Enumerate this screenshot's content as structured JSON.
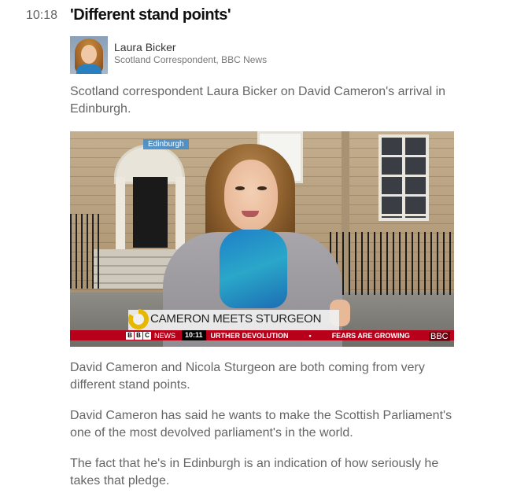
{
  "entry": {
    "time": "10:18",
    "headline": "'Different stand points'"
  },
  "author": {
    "name": "Laura Bicker",
    "role": "Scotland Correspondent, BBC News"
  },
  "intro": "Scotland correspondent Laura Bicker on David Cameron's arrival in Edinburgh.",
  "video": {
    "location_tag": "Edinburgh",
    "caption": "CAMERON MEETS STURGEON",
    "ticker": {
      "bbc_letters": [
        "B",
        "B",
        "C"
      ],
      "news_label": "NEWS",
      "time": "10:11",
      "item1": "URTHER DEVOLUTION",
      "separator": "•",
      "item2": "FEARS ARE GROWING"
    },
    "watermark": "BBC"
  },
  "paragraphs": [
    "David Cameron and Nicola Sturgeon are both coming from very different stand points.",
    "David Cameron has said he wants to make the Scottish Parliament's one of the most devolved parliament's in the world.",
    "The fact that he's in Edinburgh is an indication of how seriously he takes that pledge."
  ]
}
